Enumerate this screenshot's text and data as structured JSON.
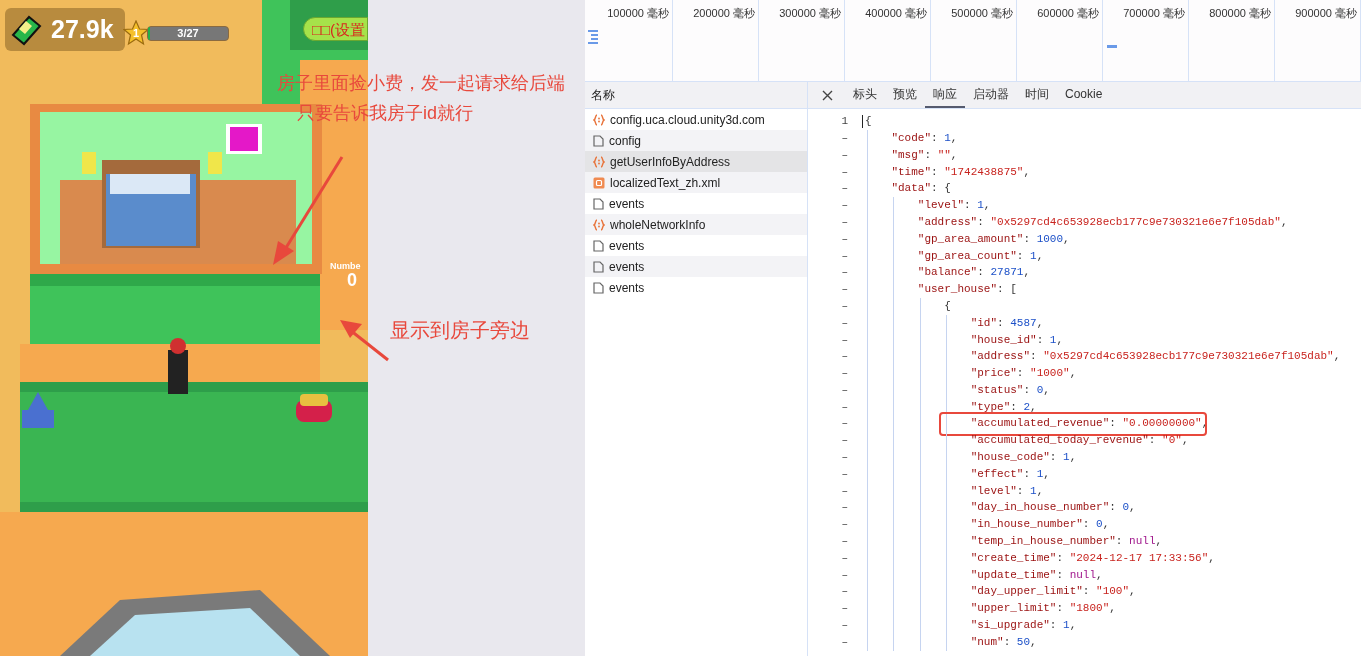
{
  "game": {
    "hud": {
      "money": "27.9k",
      "star_level": "1",
      "progress": {
        "text": "3/27",
        "level": 0.03
      },
      "settings_button": "□□(设置"
    },
    "house_label": {
      "title": "Numbe",
      "count": "0"
    }
  },
  "annotations": [
    {
      "text": "房子里面捡小费，发一起请求给后端"
    },
    {
      "text": "只要告诉我房子id就行"
    },
    {
      "text": "显示到房子旁边"
    }
  ],
  "devtools": {
    "timeline": {
      "ticks": [
        "100000 毫秒",
        "200000 毫秒",
        "300000 毫秒",
        "400000 毫秒",
        "500000 毫秒",
        "600000 毫秒",
        "700000 毫秒",
        "800000 毫秒",
        "900000 毫秒"
      ]
    },
    "name_column": {
      "header": "名称",
      "items": [
        {
          "name": "config.uca.cloud.unity3d.com",
          "kind": "script",
          "selected": false
        },
        {
          "name": "config",
          "kind": "document",
          "selected": false
        },
        {
          "name": "getUserInfoByAddress",
          "kind": "script",
          "selected": true
        },
        {
          "name": "localizedText_zh.xml",
          "kind": "xml",
          "selected": false
        },
        {
          "name": "events",
          "kind": "document",
          "selected": false
        },
        {
          "name": "wholeNetworkInfo",
          "kind": "script",
          "selected": false
        },
        {
          "name": "events",
          "kind": "document",
          "selected": false
        },
        {
          "name": "events",
          "kind": "document",
          "selected": false
        },
        {
          "name": "events",
          "kind": "document",
          "selected": false
        }
      ]
    },
    "tabs": [
      {
        "label": "标头",
        "selected": false
      },
      {
        "label": "预览",
        "selected": false
      },
      {
        "label": "响应",
        "selected": true
      },
      {
        "label": "启动器",
        "selected": false
      },
      {
        "label": "时间",
        "selected": false
      },
      {
        "label": "Cookie",
        "selected": false
      }
    ],
    "response": {
      "lines": [
        {
          "gutter": "1",
          "text": "{",
          "highlighted": false
        },
        {
          "gutter": "–",
          "text": "    \"code\": 1,",
          "highlighted": false
        },
        {
          "gutter": "–",
          "text": "    \"msg\": \"\",",
          "highlighted": false
        },
        {
          "gutter": "–",
          "text": "    \"time\": \"1742438875\",",
          "highlighted": false
        },
        {
          "gutter": "–",
          "text": "    \"data\": {",
          "highlighted": false
        },
        {
          "gutter": "–",
          "text": "        \"level\": 1,",
          "highlighted": false
        },
        {
          "gutter": "–",
          "text": "        \"address\": \"0x5297cd4c653928ecb177c9e730321e6e7f105dab\",",
          "highlighted": false
        },
        {
          "gutter": "–",
          "text": "        \"gp_area_amount\": 1000,",
          "highlighted": false
        },
        {
          "gutter": "–",
          "text": "        \"gp_area_count\": 1,",
          "highlighted": false
        },
        {
          "gutter": "–",
          "text": "        \"balance\": 27871,",
          "highlighted": false
        },
        {
          "gutter": "–",
          "text": "        \"user_house\": [",
          "highlighted": false
        },
        {
          "gutter": "–",
          "text": "            {",
          "highlighted": false
        },
        {
          "gutter": "–",
          "text": "                \"id\": 4587,",
          "highlighted": false
        },
        {
          "gutter": "–",
          "text": "                \"house_id\": 1,",
          "highlighted": false
        },
        {
          "gutter": "–",
          "text": "                \"address\": \"0x5297cd4c653928ecb177c9e730321e6e7f105dab\",",
          "highlighted": false
        },
        {
          "gutter": "–",
          "text": "                \"price\": \"1000\",",
          "highlighted": false
        },
        {
          "gutter": "–",
          "text": "                \"status\": 0,",
          "highlighted": false
        },
        {
          "gutter": "–",
          "text": "                \"type\": 2,",
          "highlighted": false
        },
        {
          "gutter": "–",
          "text": "                \"accumulated_revenue\": \"0.00000000\",",
          "highlighted": true
        },
        {
          "gutter": "–",
          "text": "                \"accumulated_today_revenue\": \"0\",",
          "highlighted": false
        },
        {
          "gutter": "–",
          "text": "                \"house_code\": 1,",
          "highlighted": false
        },
        {
          "gutter": "–",
          "text": "                \"effect\": 1,",
          "highlighted": false
        },
        {
          "gutter": "–",
          "text": "                \"level\": 1,",
          "highlighted": false
        },
        {
          "gutter": "–",
          "text": "                \"day_in_house_number\": 0,",
          "highlighted": false
        },
        {
          "gutter": "–",
          "text": "                \"in_house_number\": 0,",
          "highlighted": false
        },
        {
          "gutter": "–",
          "text": "                \"temp_in_house_number\": null,",
          "highlighted": false
        },
        {
          "gutter": "–",
          "text": "                \"create_time\": \"2024-12-17 17:33:56\",",
          "highlighted": false
        },
        {
          "gutter": "–",
          "text": "                \"update_time\": null,",
          "highlighted": false
        },
        {
          "gutter": "–",
          "text": "                \"day_upper_limit\": \"100\",",
          "highlighted": false
        },
        {
          "gutter": "–",
          "text": "                \"upper_limit\": \"1800\",",
          "highlighted": false
        },
        {
          "gutter": "–",
          "text": "                \"si_upgrade\": 1,",
          "highlighted": false
        },
        {
          "gutter": "–",
          "text": "                \"num\": 50,",
          "highlighted": false
        }
      ]
    }
  }
}
